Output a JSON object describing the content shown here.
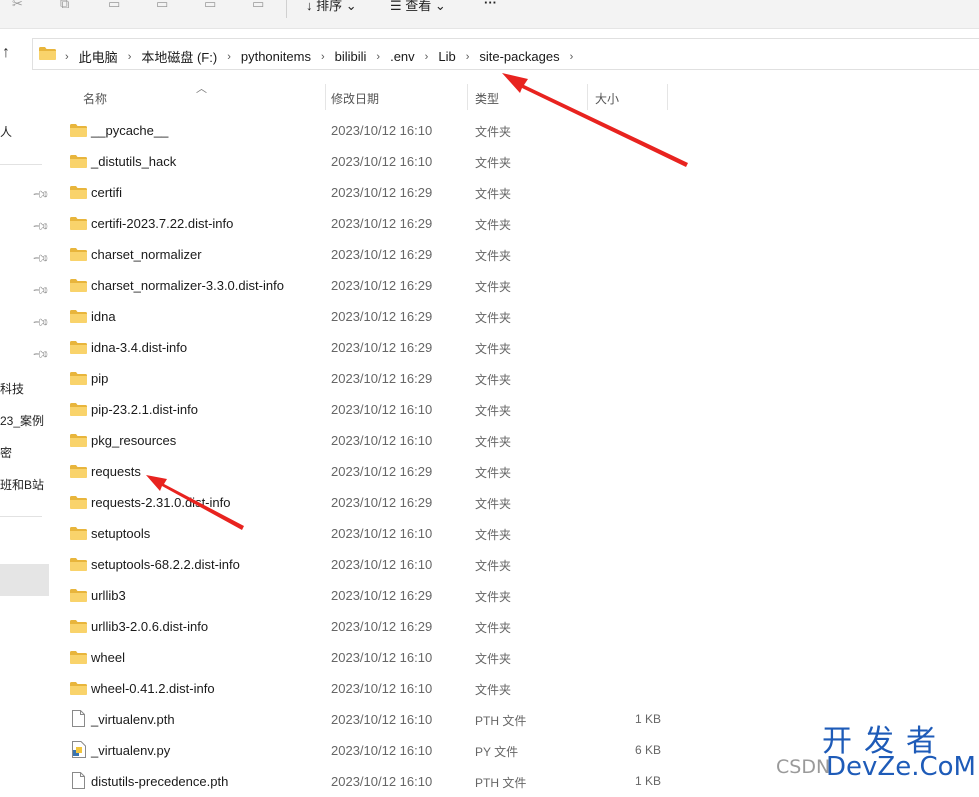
{
  "toolbar": {
    "sort_label": "排序",
    "view_label": "查看",
    "more_label": "···"
  },
  "breadcrumb": [
    "此电脑",
    "本地磁盘 (F:)",
    "pythonitems",
    "bilibili",
    ".env",
    "Lib",
    "site-packages"
  ],
  "sidebar": {
    "items": [
      "人",
      "科技",
      "23_案例",
      "密",
      "班和B站"
    ]
  },
  "columns": {
    "name": "名称",
    "date": "修改日期",
    "type": "类型",
    "size": "大小"
  },
  "files": [
    {
      "name": "__pycache__",
      "date": "2023/10/12 16:10",
      "type": "文件夹",
      "size": "",
      "icon": "folder-icon"
    },
    {
      "name": "_distutils_hack",
      "date": "2023/10/12 16:10",
      "type": "文件夹",
      "size": "",
      "icon": "folder-icon"
    },
    {
      "name": "certifi",
      "date": "2023/10/12 16:29",
      "type": "文件夹",
      "size": "",
      "icon": "folder-icon"
    },
    {
      "name": "certifi-2023.7.22.dist-info",
      "date": "2023/10/12 16:29",
      "type": "文件夹",
      "size": "",
      "icon": "folder-icon"
    },
    {
      "name": "charset_normalizer",
      "date": "2023/10/12 16:29",
      "type": "文件夹",
      "size": "",
      "icon": "folder-icon"
    },
    {
      "name": "charset_normalizer-3.3.0.dist-info",
      "date": "2023/10/12 16:29",
      "type": "文件夹",
      "size": "",
      "icon": "folder-icon"
    },
    {
      "name": "idna",
      "date": "2023/10/12 16:29",
      "type": "文件夹",
      "size": "",
      "icon": "folder-icon"
    },
    {
      "name": "idna-3.4.dist-info",
      "date": "2023/10/12 16:29",
      "type": "文件夹",
      "size": "",
      "icon": "folder-icon"
    },
    {
      "name": "pip",
      "date": "2023/10/12 16:29",
      "type": "文件夹",
      "size": "",
      "icon": "folder-icon"
    },
    {
      "name": "pip-23.2.1.dist-info",
      "date": "2023/10/12 16:10",
      "type": "文件夹",
      "size": "",
      "icon": "folder-icon"
    },
    {
      "name": "pkg_resources",
      "date": "2023/10/12 16:10",
      "type": "文件夹",
      "size": "",
      "icon": "folder-icon"
    },
    {
      "name": "requests",
      "date": "2023/10/12 16:29",
      "type": "文件夹",
      "size": "",
      "icon": "folder-icon"
    },
    {
      "name": "requests-2.31.0.dist-info",
      "date": "2023/10/12 16:29",
      "type": "文件夹",
      "size": "",
      "icon": "folder-icon"
    },
    {
      "name": "setuptools",
      "date": "2023/10/12 16:10",
      "type": "文件夹",
      "size": "",
      "icon": "folder-icon"
    },
    {
      "name": "setuptools-68.2.2.dist-info",
      "date": "2023/10/12 16:10",
      "type": "文件夹",
      "size": "",
      "icon": "folder-icon"
    },
    {
      "name": "urllib3",
      "date": "2023/10/12 16:29",
      "type": "文件夹",
      "size": "",
      "icon": "folder-icon"
    },
    {
      "name": "urllib3-2.0.6.dist-info",
      "date": "2023/10/12 16:29",
      "type": "文件夹",
      "size": "",
      "icon": "folder-icon"
    },
    {
      "name": "wheel",
      "date": "2023/10/12 16:10",
      "type": "文件夹",
      "size": "",
      "icon": "folder-icon"
    },
    {
      "name": "wheel-0.41.2.dist-info",
      "date": "2023/10/12 16:10",
      "type": "文件夹",
      "size": "",
      "icon": "folder-icon"
    },
    {
      "name": "_virtualenv.pth",
      "date": "2023/10/12 16:10",
      "type": "PTH 文件",
      "size": "1 KB",
      "icon": "file-icon"
    },
    {
      "name": "_virtualenv.py",
      "date": "2023/10/12 16:10",
      "type": "PY 文件",
      "size": "6 KB",
      "icon": "python-file-icon"
    },
    {
      "name": "distutils-precedence.pth",
      "date": "2023/10/12 16:10",
      "type": "PTH 文件",
      "size": "1 KB",
      "icon": "file-icon"
    }
  ],
  "annotation_color": "#e8231f",
  "watermark": {
    "brand_cn": "开发者",
    "prefix": "CSDN",
    "site": "DevZe.CoM"
  }
}
